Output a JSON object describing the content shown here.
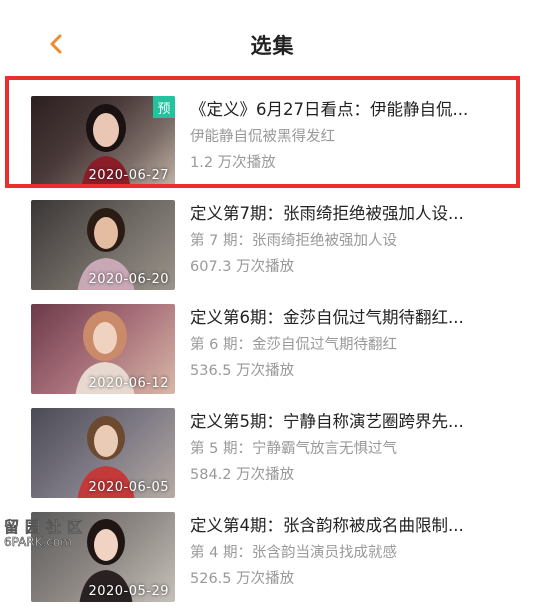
{
  "header": {
    "title": "选集",
    "back_icon": "chevron-left-icon",
    "accent_color": "#f08a2c"
  },
  "episodes": [
    {
      "title": "《定义》6月27日看点：伊能静自侃...",
      "subtitle": "伊能静自侃被黑得发红",
      "plays": "1.2 万次播放",
      "date": "2020-06-27",
      "badge": "预",
      "highlighted": true
    },
    {
      "title": "定义第7期：张雨绮拒绝被强加人设...",
      "subtitle": "第 7 期：张雨绮拒绝被强加人设",
      "plays": "607.3 万次播放",
      "date": "2020-06-20"
    },
    {
      "title": "定义第6期：金莎自侃过气期待翻红...",
      "subtitle": "第 6 期：金莎自侃过气期待翻红",
      "plays": "536.5 万次播放",
      "date": "2020-06-12"
    },
    {
      "title": "定义第5期：宁静自称演艺圈跨界先...",
      "subtitle": "第 5 期：宁静霸气放言无惧过气",
      "plays": "584.2 万次播放",
      "date": "2020-06-05"
    },
    {
      "title": "定义第4期：张含韵称被成名曲限制...",
      "subtitle": "第 4 期：张含韵当演员找成就感",
      "plays": "526.5 万次播放",
      "date": "2020-05-29"
    }
  ],
  "watermark": {
    "top": "留园社区",
    "bottom": "6PARK.com"
  },
  "colors": {
    "highlight_border": "#e8302e",
    "badge": "#25c2a0",
    "meta_text": "#999999"
  }
}
